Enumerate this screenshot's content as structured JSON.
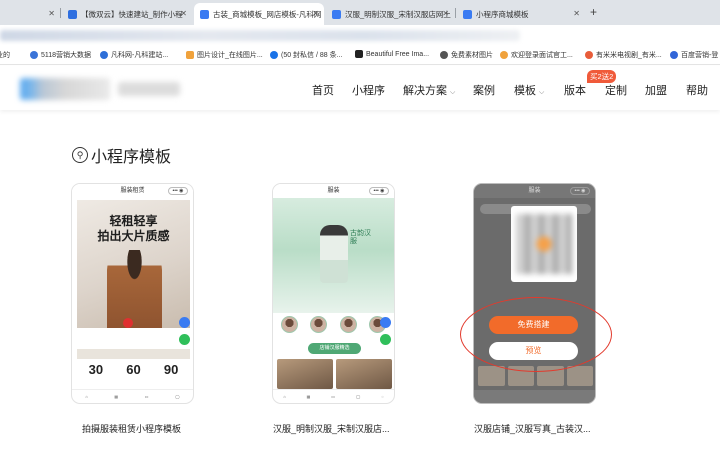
{
  "browser": {
    "tabs": [
      {
        "label": "【微双云】快速建站_制作小程"
      },
      {
        "label": "古装_商城模板_网店模板-凡科网"
      },
      {
        "label": "汉服_明制汉服_宋制汉服店网上"
      },
      {
        "label": "小程序商城模板"
      }
    ],
    "bookmarks": [
      {
        "label": "5118营销大数据"
      },
      {
        "label": "凡科网-凡科建站..."
      },
      {
        "label": "图片设计_在线图片..."
      },
      {
        "label": "(50 封私信 / 88 条..."
      },
      {
        "label": "Beautiful Free Ima..."
      },
      {
        "label": "免费素材图片"
      },
      {
        "label": "欢迎登录面试官工..."
      },
      {
        "label": "有米米电视剧_有米..."
      },
      {
        "label": "百度营销-登"
      }
    ]
  },
  "nav": {
    "items": [
      "首页",
      "小程序",
      "解决方案",
      "案例",
      "模板",
      "版本",
      "定制",
      "加盟",
      "帮助"
    ],
    "badge": "买2送2"
  },
  "section": {
    "title": "小程序模板"
  },
  "cards": [
    {
      "label": "拍摄服装租赁小程序模板",
      "phone_title": "服装租赁",
      "headline_1": "轻租轻享",
      "headline_2": "拍出大片质感",
      "stats": [
        "30",
        "60",
        "90"
      ]
    },
    {
      "label": "汉服_明制汉服_宋制汉服店...",
      "phone_title": "服装",
      "poster_text": "古韵汉服",
      "button": "店铺汉服精选"
    },
    {
      "label": "汉服店铺_汉服写真_古装汉...",
      "phone_title": "服装",
      "primary_button": "免费搭建",
      "secondary_button": "预览"
    }
  ],
  "colors": {
    "accent_orange": "#f26b2a",
    "annotation_red": "#e23a2d",
    "badge_red": "#f05a3a",
    "card2_green": "#4fa875"
  }
}
